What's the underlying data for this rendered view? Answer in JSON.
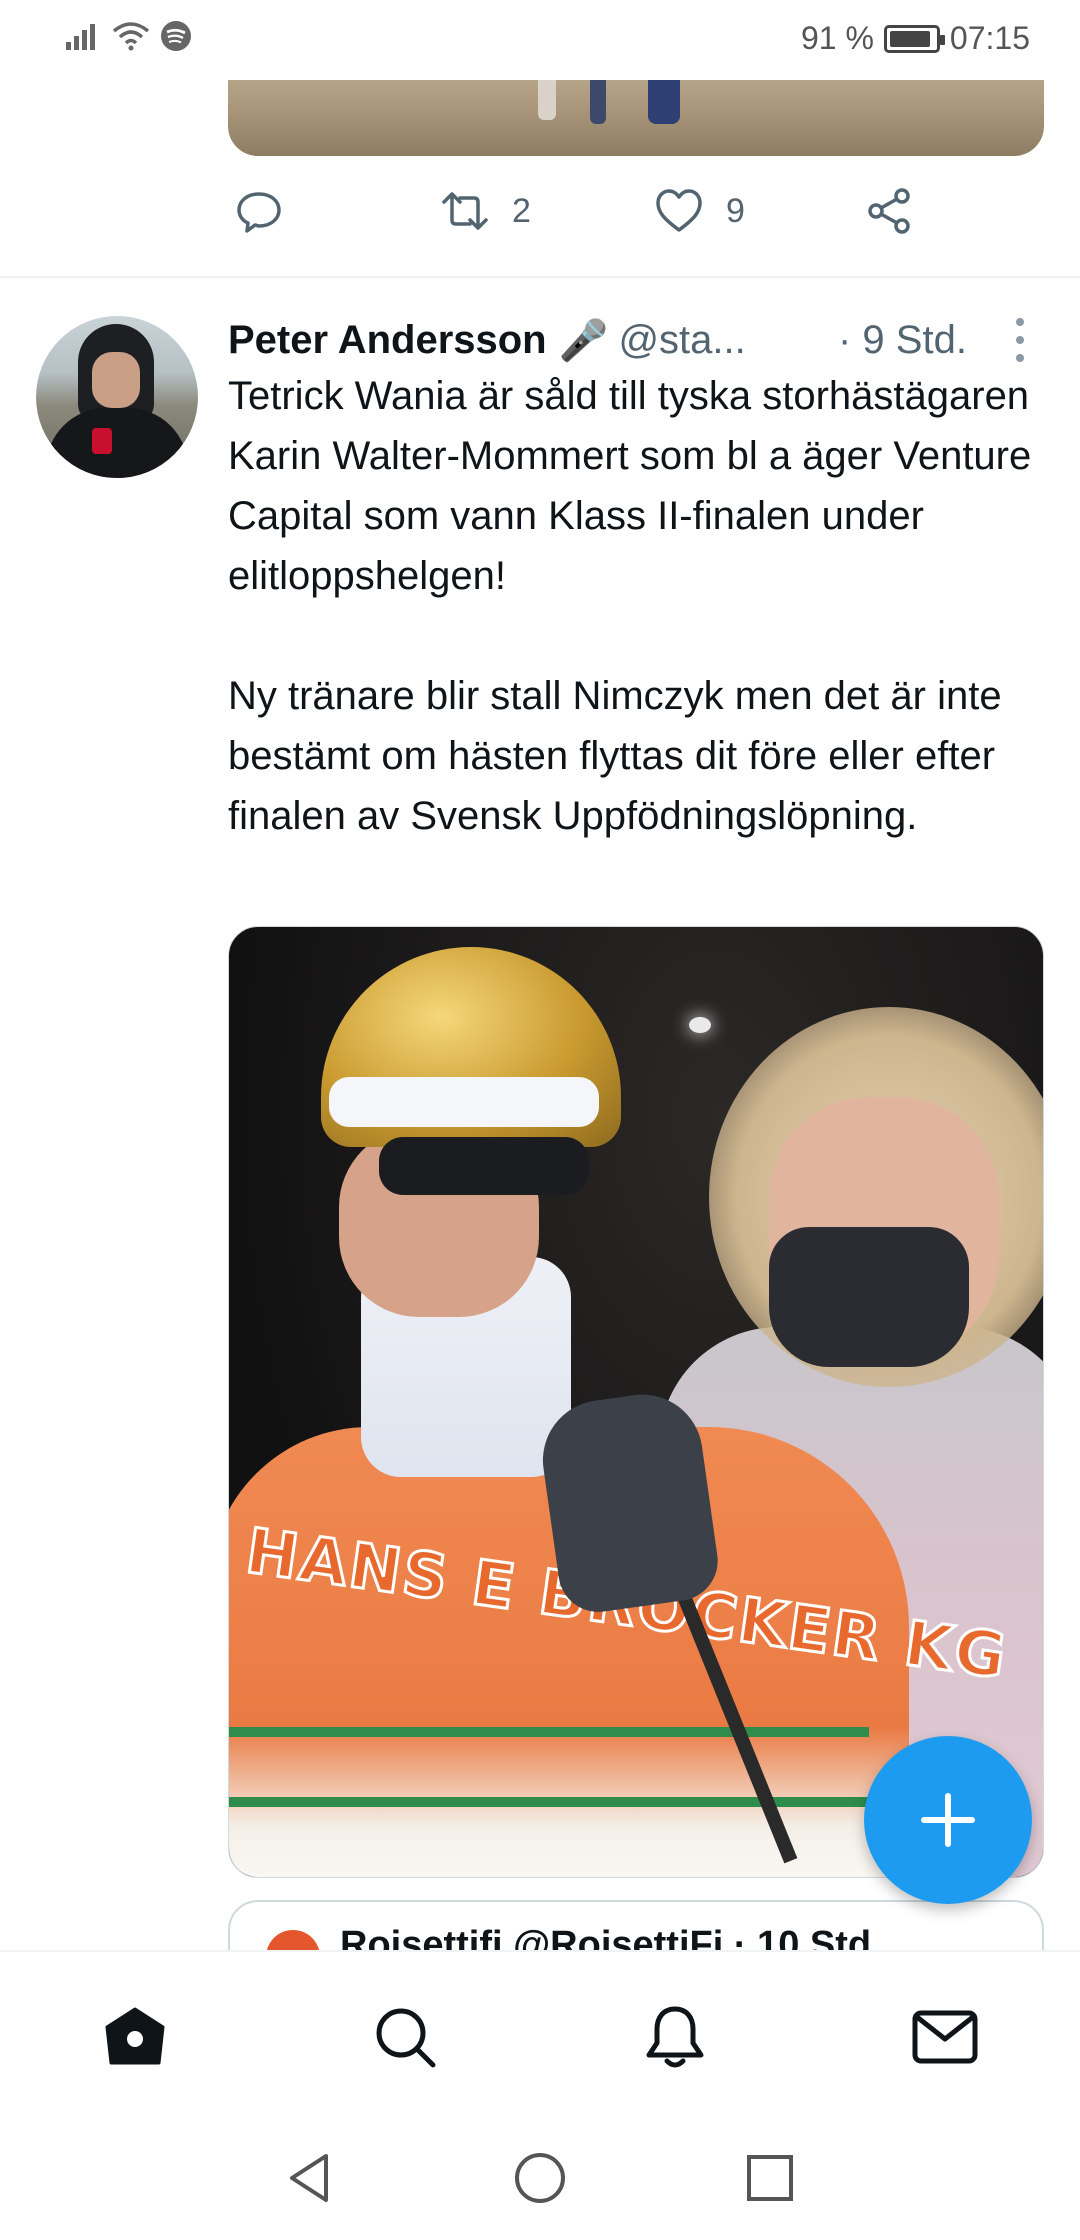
{
  "status_bar": {
    "battery_percent": "91 %",
    "battery_level": 0.91,
    "time": "07:15",
    "icons": [
      "signal-icon",
      "wifi-icon",
      "spotify-icon"
    ]
  },
  "previous_tweet": {
    "reply_count": "",
    "retweet_count": "2",
    "like_count": "9"
  },
  "tweet": {
    "author_name": "Peter Andersson",
    "author_emoji": "🎤",
    "handle": "@sta...",
    "time": "· 9 Std.",
    "text": "Tetrick Wania är såld till tyska storhästägaren Karin Walter-Mommert som bl a äger Venture Capital som vann Klass II-finalen under elitloppshelgen!\n\nNy tränare blir stall Nimczyk men det är inte bestämt om hästen flyttas dit före eller efter finalen av Svensk Uppfödningslöpning.",
    "image_jacket_text": "HANS E BROCKER KG",
    "quoted_preview": "Rojsettifi @RojsettiFi · 10 Std"
  },
  "colors": {
    "accent": "#1d9bf0",
    "text_primary": "#0f1419",
    "text_secondary": "#536471"
  },
  "bottom_nav": [
    "home-icon",
    "search-icon",
    "notifications-icon",
    "messages-icon"
  ],
  "system_nav": [
    "back-icon",
    "home-circle-icon",
    "recents-icon"
  ]
}
